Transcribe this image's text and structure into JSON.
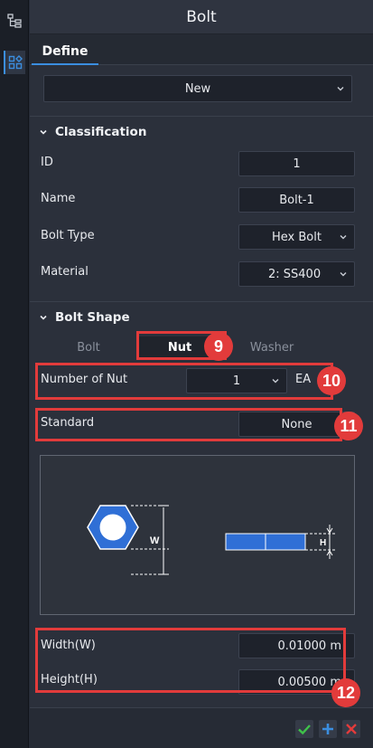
{
  "panel": {
    "title": "Bolt"
  },
  "tabs": {
    "define": "Define"
  },
  "mode_select": {
    "value": "New"
  },
  "classification": {
    "header": "Classification",
    "id_label": "ID",
    "id_value": "1",
    "name_label": "Name",
    "name_value": "Bolt-1",
    "bolt_type_label": "Bolt Type",
    "bolt_type_value": "Hex Bolt",
    "material_label": "Material",
    "material_value": "2: SS400"
  },
  "bolt_shape": {
    "header": "Bolt Shape",
    "subtabs": [
      "Bolt",
      "Nut",
      "Washer"
    ],
    "number_of_nut_label": "Number of Nut",
    "number_of_nut_value": "1",
    "number_of_nut_unit": "EA",
    "standard_label": "Standard",
    "standard_value": "None",
    "diagram": {
      "width_mark": "W",
      "height_mark": "H"
    },
    "width_label": "Width(W)",
    "width_value": "0.01000 m",
    "height_label": "Height(H)",
    "height_value": "0.00500 m"
  },
  "callouts": [
    "9",
    "10",
    "11",
    "12"
  ],
  "colors": {
    "accent": "#3b8ee0",
    "highlight": "#e23b3b",
    "confirm": "#3fc24a",
    "add": "#3b8ee0",
    "cancel": "#e23b3b"
  },
  "icons": [
    "tree-view-icon",
    "components-icon",
    "chevron-down-icon",
    "check-icon",
    "plus-icon",
    "close-icon"
  ]
}
